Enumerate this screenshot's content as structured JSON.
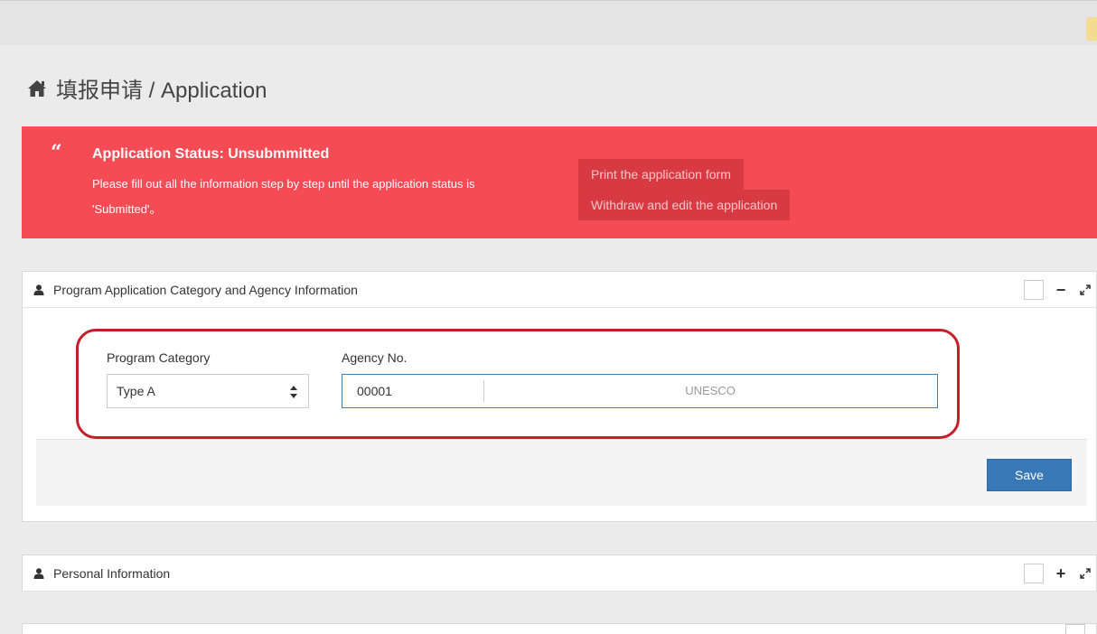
{
  "page": {
    "title": "填报申请 / Application",
    "title_icon": "home-icon"
  },
  "alert": {
    "icon": "quote-icon",
    "quote_glyph": "“",
    "title": "Application Status: Unsubmmitted",
    "message": "Please fill out all the information step by step until the application status is 'Submitted'。",
    "print_label": "Print the application form",
    "withdraw_label": "Withdraw and edit the application",
    "color": "#f54b55"
  },
  "panels": {
    "program": {
      "title": "Program Application Category and Agency Information",
      "icon": "user-icon",
      "collapse_glyph": "−",
      "program_category_label": "Program Category",
      "program_category_value": "Type A",
      "agency_label": "Agency No.",
      "agency_no": "00001",
      "agency_name": "UNESCO",
      "save_label": "Save"
    },
    "personal": {
      "title": "Personal Information",
      "icon": "user-icon",
      "expand_glyph": "+"
    }
  },
  "colors": {
    "accent": "#3878b6",
    "highlight": "#c41e2a"
  }
}
